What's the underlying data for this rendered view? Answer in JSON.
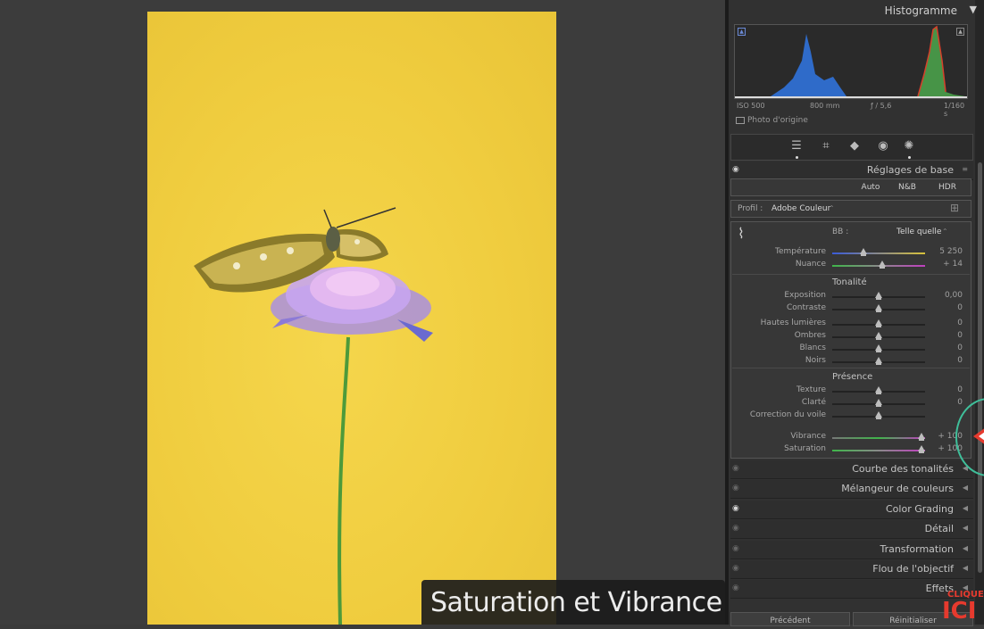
{
  "histogram": {
    "title": "Histogramme",
    "iso": "ISO 500",
    "focal": "800 mm",
    "aperture": "ƒ / 5,6",
    "shutter": "1/160 s",
    "original_photo": "Photo d'origine"
  },
  "toolbar": {
    "icons": [
      "sliders-icon",
      "crop-icon",
      "eraser-icon",
      "redeye-icon",
      "masking-icon"
    ]
  },
  "basic": {
    "title": "Réglages de base",
    "modes": [
      "Auto",
      "N&B",
      "HDR"
    ],
    "profile_label": "Profil :",
    "profile_value": "Adobe Couleur",
    "wb_label": "BB :",
    "wb_value": "Telle quelle",
    "wb_sliders": [
      {
        "label": "Température",
        "value": "5 250",
        "pos": 0.34
      },
      {
        "label": "Nuance",
        "value": "+ 14",
        "pos": 0.54
      }
    ],
    "tone_title": "Tonalité",
    "tone_sliders": [
      {
        "label": "Exposition",
        "value": "0,00",
        "pos": 0.5
      },
      {
        "label": "Contraste",
        "value": "0",
        "pos": 0.5
      },
      {
        "label": "Hautes lumières",
        "value": "0",
        "pos": 0.5
      },
      {
        "label": "Ombres",
        "value": "0",
        "pos": 0.5
      },
      {
        "label": "Blancs",
        "value": "0",
        "pos": 0.5
      },
      {
        "label": "Noirs",
        "value": "0",
        "pos": 0.5
      }
    ],
    "presence_title": "Présence",
    "presence_sliders": [
      {
        "label": "Texture",
        "value": "0",
        "pos": 0.5
      },
      {
        "label": "Clarté",
        "value": "0",
        "pos": 0.5
      },
      {
        "label": "Correction du voile",
        "value": "",
        "pos": 0.5
      }
    ],
    "color_sliders": [
      {
        "label": "Vibrance",
        "value": "+ 100",
        "pos": 0.96
      },
      {
        "label": "Saturation",
        "value": "+ 100",
        "pos": 0.96
      }
    ]
  },
  "sections": [
    "Courbe des tonalités",
    "Mélangeur de couleurs",
    "Color Grading",
    "Détail",
    "Transformation",
    "Flou de l'objectif",
    "Effets"
  ],
  "buttons": {
    "previous": "Précédent",
    "reset": "Réinitialiser"
  },
  "caption": "Saturation et Vibrance",
  "overlay": {
    "cliquez": "CLIQUEZ",
    "ici": "ICI"
  },
  "colors": {
    "photo_bg": "#f0cd3f",
    "accent_green": "#3fbf9a",
    "accent_red": "#e63a2e"
  }
}
